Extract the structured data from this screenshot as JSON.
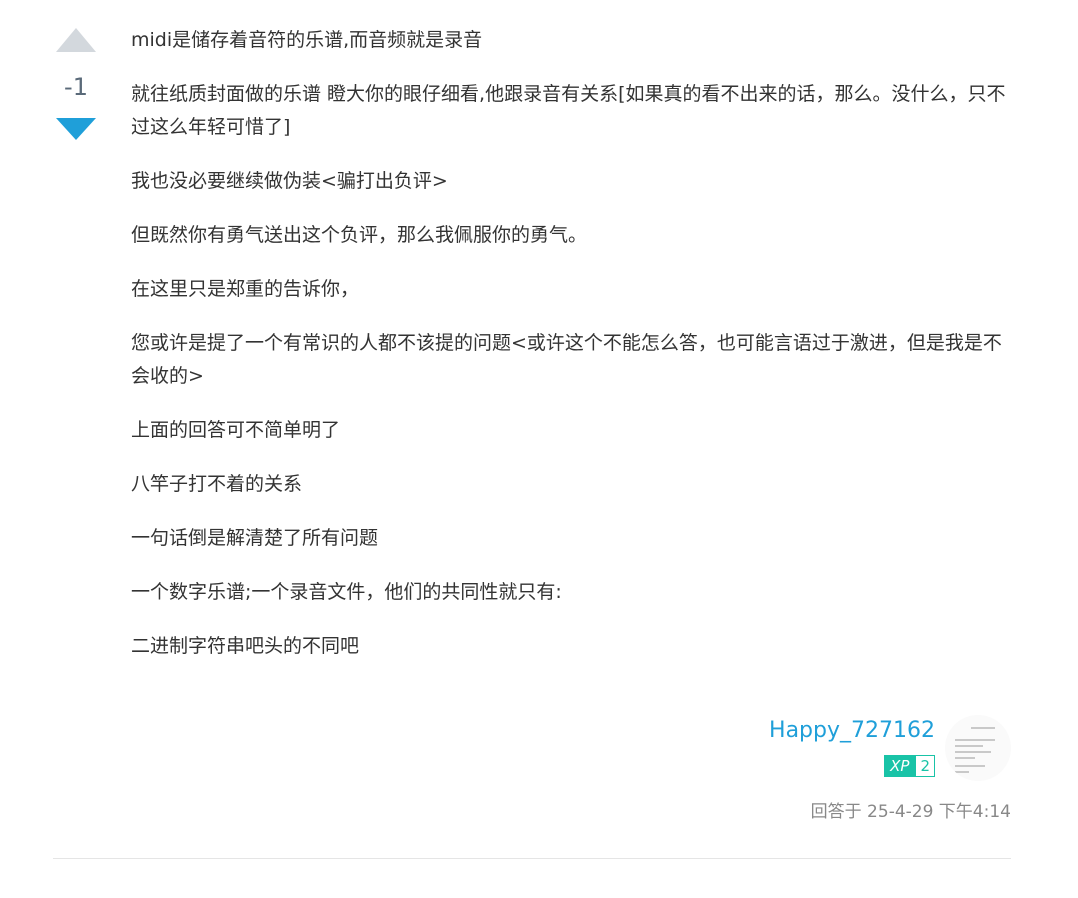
{
  "vote": {
    "count": "-1",
    "up_icon": "triangle-up-icon",
    "down_icon": "triangle-down-icon",
    "up_color": "#d3d8dd",
    "down_color": "#1f9fd9"
  },
  "answer": {
    "paragraphs": [
      "midi是储存着音符的乐谱,而音频就是录音",
      "就往纸质封面做的乐谱 瞪大你的眼仔细看,他跟录音有关系[如果真的看不出来的话，那么。没什么，只不过这么年轻可惜了]",
      "我也没必要继续做伪装<骗打出负评>",
      "但既然你有勇气送出这个负评，那么我佩服你的勇气。",
      "在这里只是郑重的告诉你，",
      "您或许是提了一个有常识的人都不该提的问题<或许这个不能怎么答，也可能言语过于激进，但是我是不会收的>",
      "上面的回答可不简单明了",
      "八竿子打不着的关系",
      "一句话倒是解清楚了所有问题",
      "一个数字乐谱;一个录音文件，他们的共同性就只有:",
      "二进制字符串吧头的不同吧"
    ]
  },
  "author": {
    "name": "Happy_727162",
    "xp_label": "XP",
    "xp_level": "2",
    "name_color": "#1f9fd9",
    "badge_color": "#19c3a7"
  },
  "meta": {
    "answered_at": "回答于 25-4-29 下午4:14"
  }
}
